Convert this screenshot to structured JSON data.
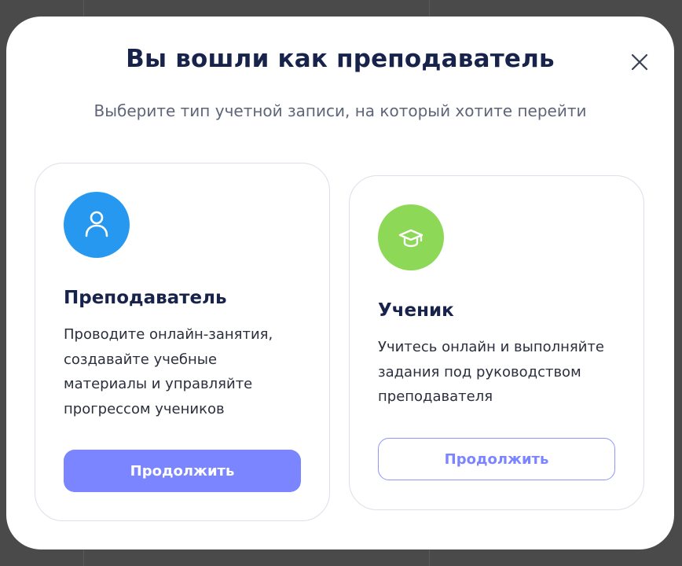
{
  "modal": {
    "title": "Вы вошли как преподаватель",
    "subtitle": "Выберите тип учетной записи, на который хотите перейти"
  },
  "cards": [
    {
      "title": "Преподаватель",
      "description": "Проводите онлайн-занятия, создавайте учебные материалы и управляйте прогрессом учеников",
      "button_label": "Продолжить",
      "icon": "user-icon",
      "icon_bg": "#2798f0",
      "button_style": "filled"
    },
    {
      "title": "Ученик",
      "description": "Учитесь онлайн и выполняйте задания под руководством преподавателя",
      "button_label": "Продолжить",
      "icon": "graduation-cap-icon",
      "icon_bg": "#8ed857",
      "button_style": "outline"
    }
  ],
  "colors": {
    "accent": "#7b85ff",
    "heading": "#17234a",
    "overlay": "#4a4a4a"
  }
}
